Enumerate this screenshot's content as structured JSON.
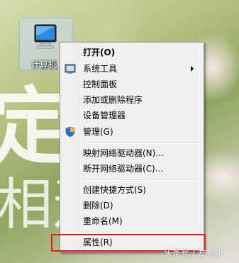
{
  "desktop": {
    "icon_label": "计算机",
    "wallpaper_text_1": "定",
    "wallpaper_text_2": "相遇",
    "watermark": "头条号 / 友为新"
  },
  "context_menu": {
    "items": [
      {
        "label": "打开(O)",
        "bold": true
      },
      {
        "label": "系统工具",
        "icon": "system-tools-icon",
        "submenu": true
      },
      {
        "label": "控制面板"
      },
      {
        "label": "添加或删除程序"
      },
      {
        "label": "设备管理器"
      },
      {
        "label": "管理(G)",
        "icon": "uac-shield-icon"
      },
      {
        "label": "映射网络驱动器(N)..."
      },
      {
        "label": "断开网络驱动器(C)..."
      },
      {
        "label": "创建快捷方式(S)"
      },
      {
        "label": "删除(D)"
      },
      {
        "label": "重命名(M)"
      },
      {
        "label": "属性(R)",
        "highlighted": true
      }
    ]
  },
  "colors": {
    "highlight_box": "#e02020",
    "menu_background": "#f0f0f0"
  }
}
